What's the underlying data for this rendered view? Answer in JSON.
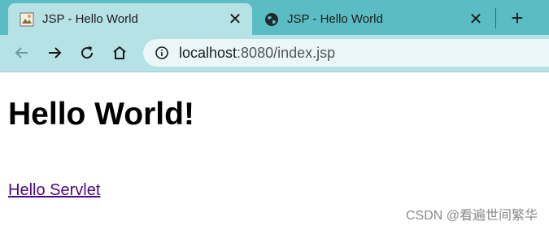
{
  "tabs": [
    {
      "title": "JSP - Hello World",
      "favicon": "image-favicon-icon",
      "active": true
    },
    {
      "title": "JSP - Hello World",
      "favicon": "globe-icon",
      "active": false
    }
  ],
  "tab_close_symbol": "✕",
  "new_tab_symbol": "+",
  "address_bar": {
    "host": "localhost",
    "rest": ":8080/index.jsp",
    "icon": "info-icon"
  },
  "page": {
    "heading": "Hello World!",
    "link_text": "Hello Servlet"
  },
  "watermark": "CSDN @看遍世间繁华",
  "colors": {
    "tab_bar": "#5cbcc3",
    "active_tab": "#b6e1e5",
    "toolbar": "#b6e1e5",
    "omnibox": "#eaf6f7",
    "visited_link": "#4b0a84"
  }
}
